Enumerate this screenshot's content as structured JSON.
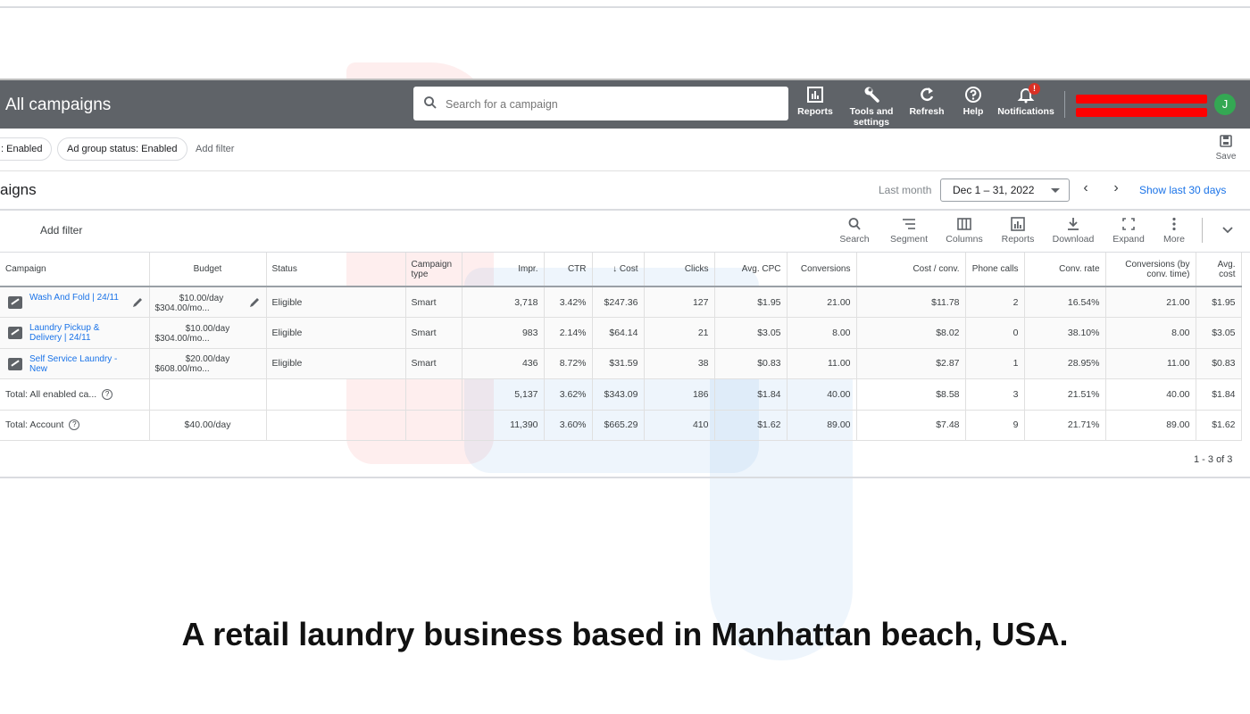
{
  "header": {
    "title": "All campaigns",
    "search_placeholder": "Search for a campaign",
    "buttons": {
      "reports": "Reports",
      "tools_line1": "Tools and",
      "tools_line2": "settings",
      "refresh": "Refresh",
      "help": "Help",
      "notifications": "Notifications"
    },
    "notification_badge": "!",
    "avatar_initial": "J"
  },
  "filters": {
    "chip1": ": Enabled",
    "chip2": "Ad group status: Enabled",
    "add_filter": "Add filter",
    "save": "Save"
  },
  "subheader": {
    "title": "aigns",
    "last_month": "Last month",
    "date_range": "Dec 1 – 31, 2022",
    "show_last": "Show last 30 days"
  },
  "toolbar": {
    "add_filter": "Add filter",
    "search": "Search",
    "segment": "Segment",
    "columns": "Columns",
    "reports": "Reports",
    "download": "Download",
    "expand": "Expand",
    "more": "More"
  },
  "table": {
    "columns": {
      "campaign": "Campaign",
      "budget": "Budget",
      "status": "Status",
      "campaign_type": "Campaign type",
      "impr": "Impr.",
      "ctr": "CTR",
      "cost": "↓ Cost",
      "clicks": "Clicks",
      "avg_cpc": "Avg. CPC",
      "conversions": "Conversions",
      "cost_conv": "Cost / conv.",
      "phone_calls": "Phone calls",
      "conv_rate": "Conv. rate",
      "conv_by_time": "Conversions (by conv. time)",
      "avg_cost": "Avg. cost"
    },
    "rows": [
      {
        "campaign": "Wash And Fold | 24/11",
        "budget1": "$10.00/day",
        "budget2": "$304.00/mo...",
        "status": "Eligible",
        "type": "Smart",
        "impr": "3,718",
        "ctr": "3.42%",
        "cost": "$247.36",
        "clicks": "127",
        "avg_cpc": "$1.95",
        "conversions": "21.00",
        "cost_conv": "$11.78",
        "phone_calls": "2",
        "conv_rate": "16.54%",
        "conv_time": "21.00",
        "avg_cost": "$1.95"
      },
      {
        "campaign": "Laundry Pickup & Delivery | 24/11",
        "budget1": "$10.00/day",
        "budget2": "$304.00/mo...",
        "status": "Eligible",
        "type": "Smart",
        "impr": "983",
        "ctr": "2.14%",
        "cost": "$64.14",
        "clicks": "21",
        "avg_cpc": "$3.05",
        "conversions": "8.00",
        "cost_conv": "$8.02",
        "phone_calls": "0",
        "conv_rate": "38.10%",
        "conv_time": "8.00",
        "avg_cost": "$3.05"
      },
      {
        "campaign": "Self Service Laundry - New",
        "budget1": "$20.00/day",
        "budget2": "$608.00/mo...",
        "status": "Eligible",
        "type": "Smart",
        "impr": "436",
        "ctr": "8.72%",
        "cost": "$31.59",
        "clicks": "38",
        "avg_cpc": "$0.83",
        "conversions": "11.00",
        "cost_conv": "$2.87",
        "phone_calls": "1",
        "conv_rate": "28.95%",
        "conv_time": "11.00",
        "avg_cost": "$0.83"
      }
    ],
    "totals": [
      {
        "label": "Total: All enabled ca...",
        "budget": "",
        "impr": "5,137",
        "ctr": "3.62%",
        "cost": "$343.09",
        "clicks": "186",
        "avg_cpc": "$1.84",
        "conversions": "40.00",
        "cost_conv": "$8.58",
        "phone_calls": "3",
        "conv_rate": "21.51%",
        "conv_time": "40.00",
        "avg_cost": "$1.84"
      },
      {
        "label": "Total: Account",
        "budget": "$40.00/day",
        "impr": "11,390",
        "ctr": "3.60%",
        "cost": "$665.29",
        "clicks": "410",
        "avg_cpc": "$1.62",
        "conversions": "89.00",
        "cost_conv": "$7.48",
        "phone_calls": "9",
        "conv_rate": "21.71%",
        "conv_time": "89.00",
        "avg_cost": "$1.62"
      }
    ],
    "pagination": "1 - 3 of 3"
  },
  "caption": "A retail laundry business based in Manhattan beach, USA.",
  "colors": {
    "header_bg": "#5f6368",
    "link_blue": "#1a73e8",
    "avatar_green": "#34a853",
    "redaction_red": "#ff0000"
  }
}
